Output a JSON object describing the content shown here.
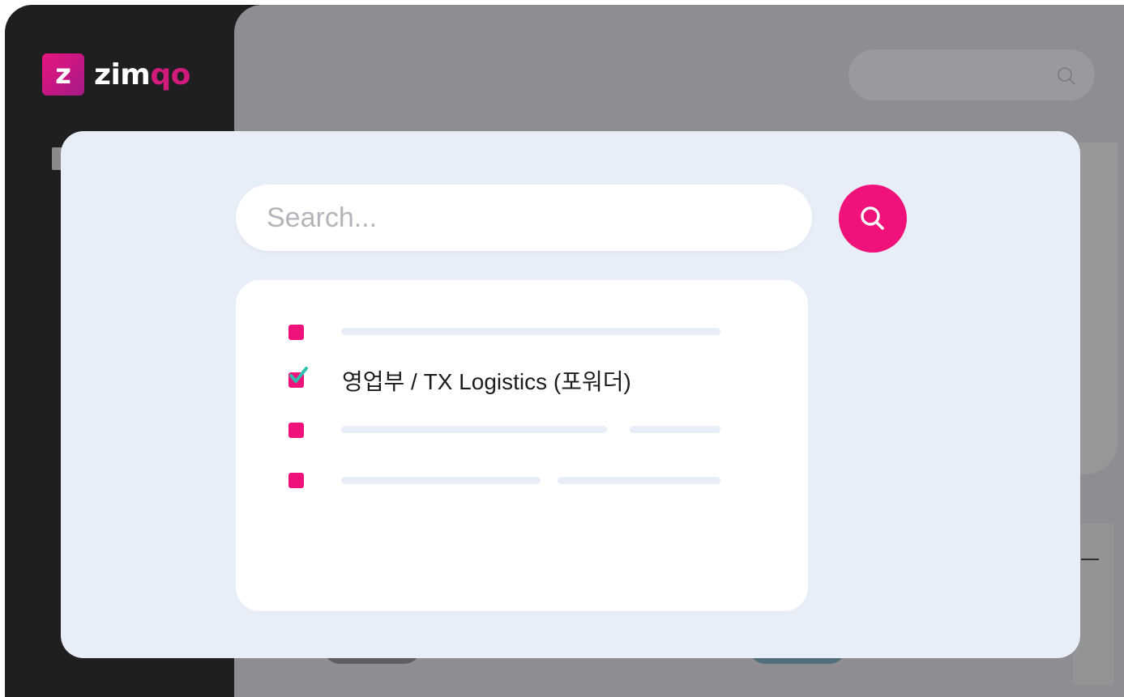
{
  "brand": {
    "mark": "z",
    "name_start": "zim",
    "name_accent": "qo",
    "colors": {
      "accent": "#f0117a",
      "sidebar_bg": "#1f1f21",
      "modal_bg": "#e8eef7"
    }
  },
  "background": {
    "search_icon": "search-icon"
  },
  "modal": {
    "search": {
      "placeholder": "Search...",
      "value": ""
    },
    "search_button_icon": "search-icon",
    "results": [
      {
        "checked": false,
        "text": ""
      },
      {
        "checked": true,
        "text": "영업부 / TX Logistics (포워더)"
      },
      {
        "checked": false,
        "text": ""
      },
      {
        "checked": false,
        "text": ""
      }
    ]
  }
}
